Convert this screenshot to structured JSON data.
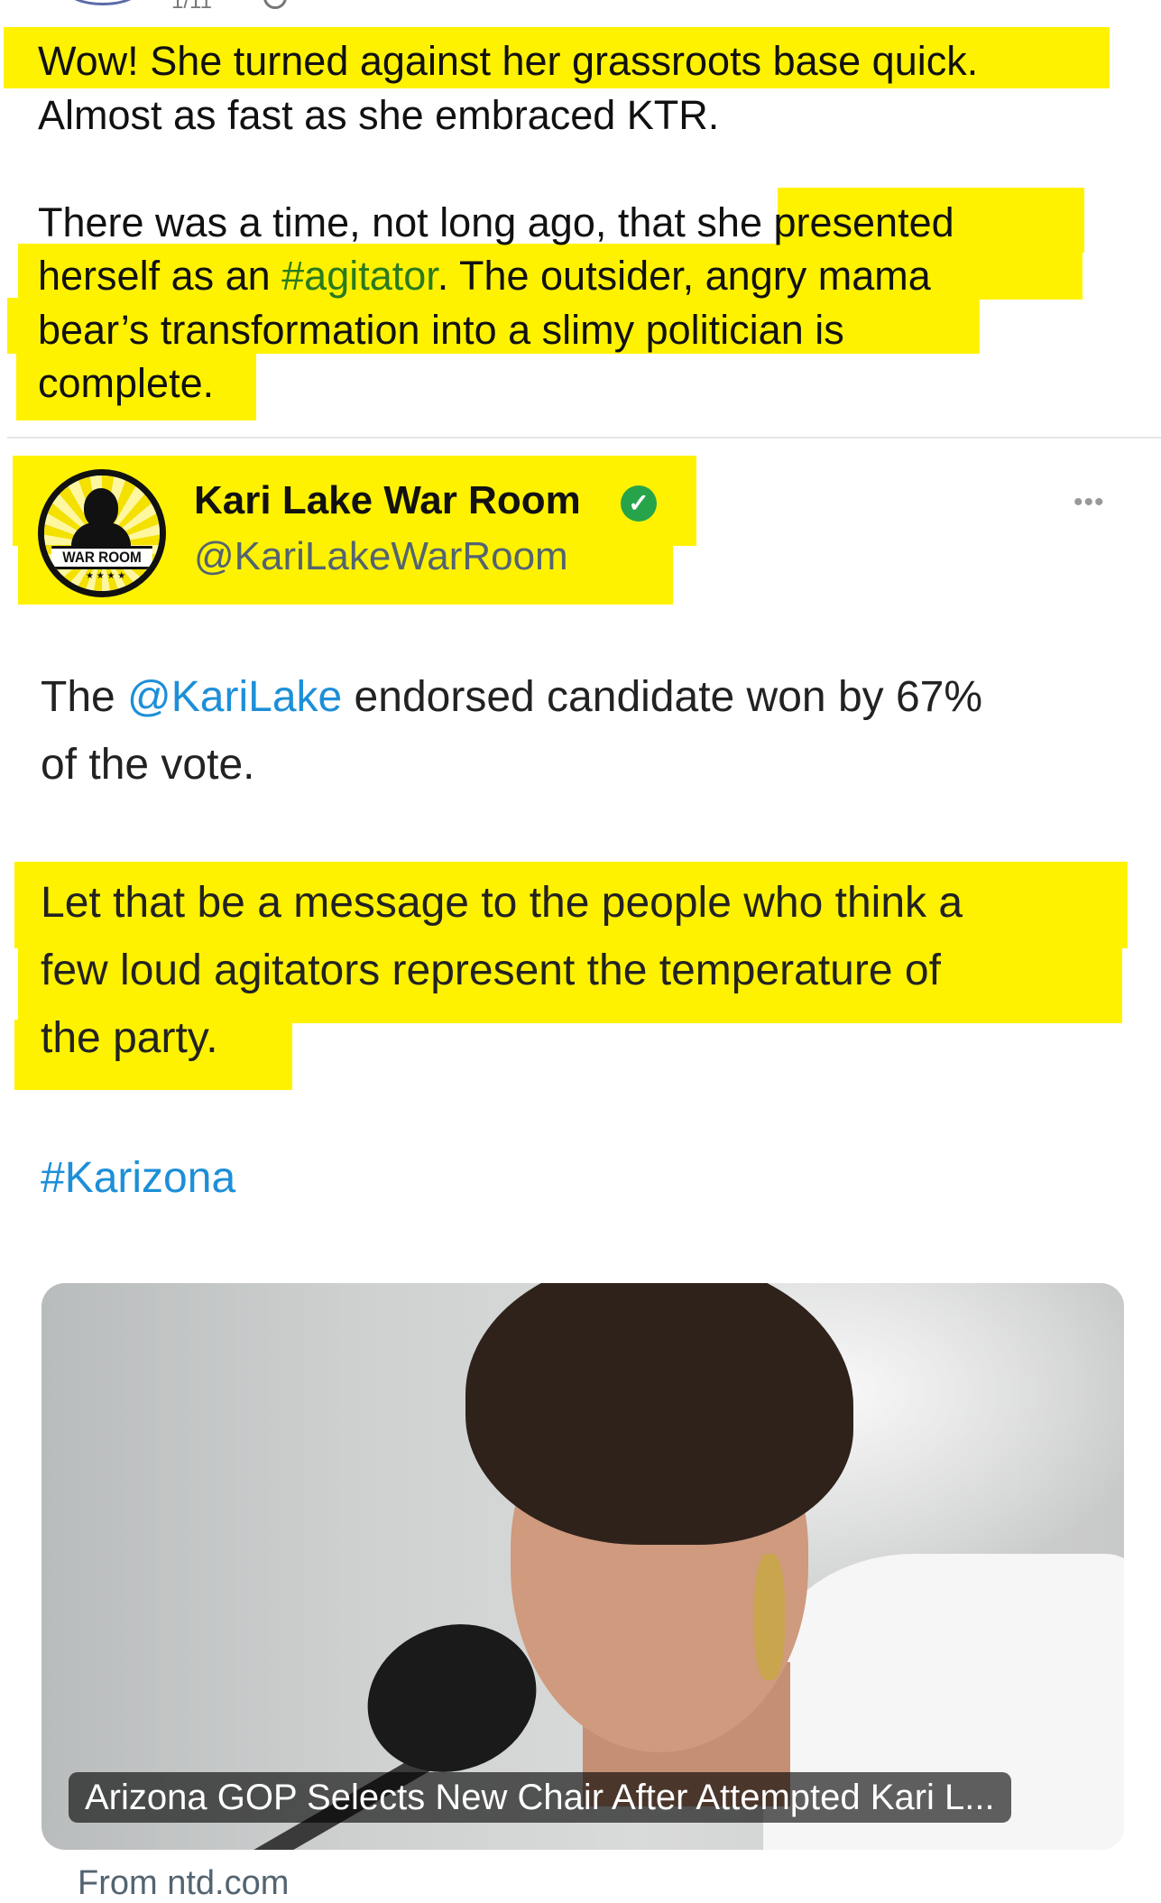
{
  "header": {
    "date_partial": "1/11"
  },
  "post": {
    "line1": "Wow! She turned against her grassroots base quick.",
    "line2": "Almost as fast as she embraced KTR.",
    "para2_start": "There was a time, not long ago, that she presented",
    "para2_line2_pre": "herself as an ",
    "hashtag_agitator": "#agitator",
    "para2_line2_post": ". The outsider, angry mama",
    "para2_line3": "bear’s transformation into a slimy politician is",
    "para2_line4": "complete.",
    "hashtag_color": "#2a7a1e"
  },
  "tweet": {
    "logo_text": "WAR ROOM",
    "author_name": "Kari Lake War Room",
    "handle": "@KariLakeWarRoom",
    "more_label": "•••",
    "body1_pre": "The ",
    "mention": "@KariLake",
    "body1_post": " endorsed candidate won by 67%",
    "body1_line2": "of the vote.",
    "body2_line1": "Let that be a message to the people who think a",
    "body2_line2": "few loud agitators represent the temperature of",
    "body2_line3": "the party.",
    "hashtag": "#Karizona",
    "link_color": "#1d8fd8",
    "verified_color": "#27a44a"
  },
  "media": {
    "caption": "Arizona GOP Selects New Chair After Attempted Kari L...",
    "source": "From ntd.com"
  },
  "highlight_color": "#fff200"
}
